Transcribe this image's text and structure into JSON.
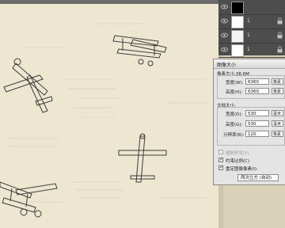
{
  "layers": {
    "rows": [
      {
        "name": "",
        "thumb": "#000000"
      },
      {
        "name": "1",
        "thumb": "#ffffff"
      },
      {
        "name": "1",
        "thumb": "#f4f4f4"
      },
      {
        "name": "1",
        "thumb": "#ffffff"
      }
    ]
  },
  "dialog": {
    "title": "图像大小",
    "pixel_dimensions": "像素大小:38.6M",
    "width_label": "宽度(W):",
    "width_value": "6360",
    "width_unit": "像素",
    "height_label": "高度(H):",
    "height_value": "6360",
    "height_unit": "像素",
    "doc_size_label": "文档大小:",
    "doc_width_label": "宽度(D):",
    "doc_width_value": "530",
    "doc_width_unit": "毫米",
    "doc_height_label": "高度(G):",
    "doc_height_value": "530",
    "doc_height_unit": "毫米",
    "resolution_label": "分辨率(R):",
    "resolution_value": "120",
    "resolution_unit": "像素",
    "scale_styles_label": "缩放样式(Y)",
    "constrain_label": "约束比例(C)",
    "resample_label": "重定图像像素(I):",
    "resample_method": "两次立方 (自动)"
  },
  "colors": {
    "paper": "#ede6d0",
    "panel_dark": "#4d4d4d",
    "dialog_bg": "#e4e4e4"
  }
}
